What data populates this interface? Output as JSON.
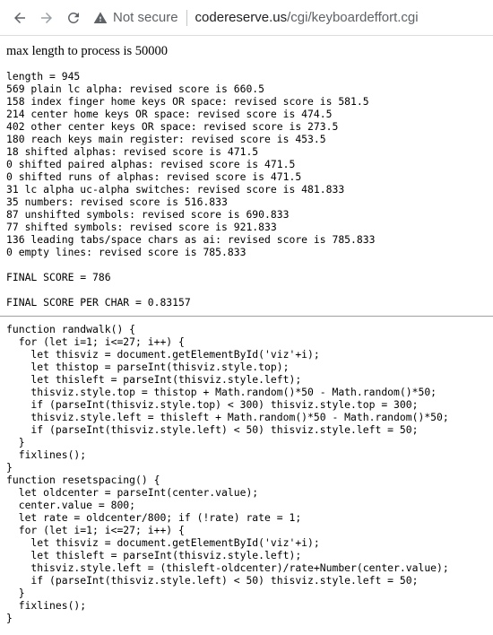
{
  "browser": {
    "security_label": "Not secure",
    "url_host": "codereserve.us",
    "url_path": "/cgi/keyboardeffort.cgi"
  },
  "page": {
    "max_length_line": "max length to process is 50000",
    "stats_block": "length = 945\n569 plain lc alpha: revised score is 660.5\n158 index finger home keys OR space: revised score is 581.5\n214 center home keys OR space: revised score is 474.5\n402 other center keys OR space: revised score is 273.5\n180 reach keys main register: revised score is 453.5\n18 shifted alphas: revised score is 471.5\n0 shifted paired alphas: revised score is 471.5\n0 shifted runs of alphas: revised score is 471.5\n31 lc alpha uc-alpha switches: revised score is 481.833\n35 numbers: revised score is 516.833\n87 unshifted symbols: revised score is 690.833\n77 shifted symbols: revised score is 921.833\n136 leading tabs/space chars as ai: revised score is 785.833\n0 empty lines: revised score is 785.833",
    "final_score": "FINAL SCORE = 786",
    "final_score_per_char": "FINAL SCORE PER CHAR = 0.83157",
    "code_block": "function randwalk() {\n  for (let i=1; i<=27; i++) {\n    let thisviz = document.getElementById('viz'+i);\n    let thistop = parseInt(thisviz.style.top);\n    let thisleft = parseInt(thisviz.style.left);\n    thisviz.style.top = thistop + Math.random()*50 - Math.random()*50;\n    if (parseInt(thisviz.style.top) < 300) thisviz.style.top = 300;\n    thisviz.style.left = thisleft + Math.random()*50 - Math.random()*50;\n    if (parseInt(thisviz.style.left) < 50) thisviz.style.left = 50;\n  }\n  fixlines();\n}\nfunction resetspacing() {\n  let oldcenter = parseInt(center.value);\n  center.value = 800;\n  let rate = oldcenter/800; if (!rate) rate = 1;\n  for (let i=1; i<=27; i++) {\n    let thisviz = document.getElementById('viz'+i);\n    let thisleft = parseInt(thisviz.style.left);\n    thisviz.style.left = (thisleft-oldcenter)/rate+Number(center.value);\n    if (parseInt(thisviz.style.left) < 50) thisviz.style.left = 50;\n  }\n  fixlines();\n}"
  },
  "icons": {
    "back": "back-arrow-icon",
    "forward": "forward-arrow-icon",
    "reload": "reload-icon",
    "security": "warning-triangle-icon"
  }
}
